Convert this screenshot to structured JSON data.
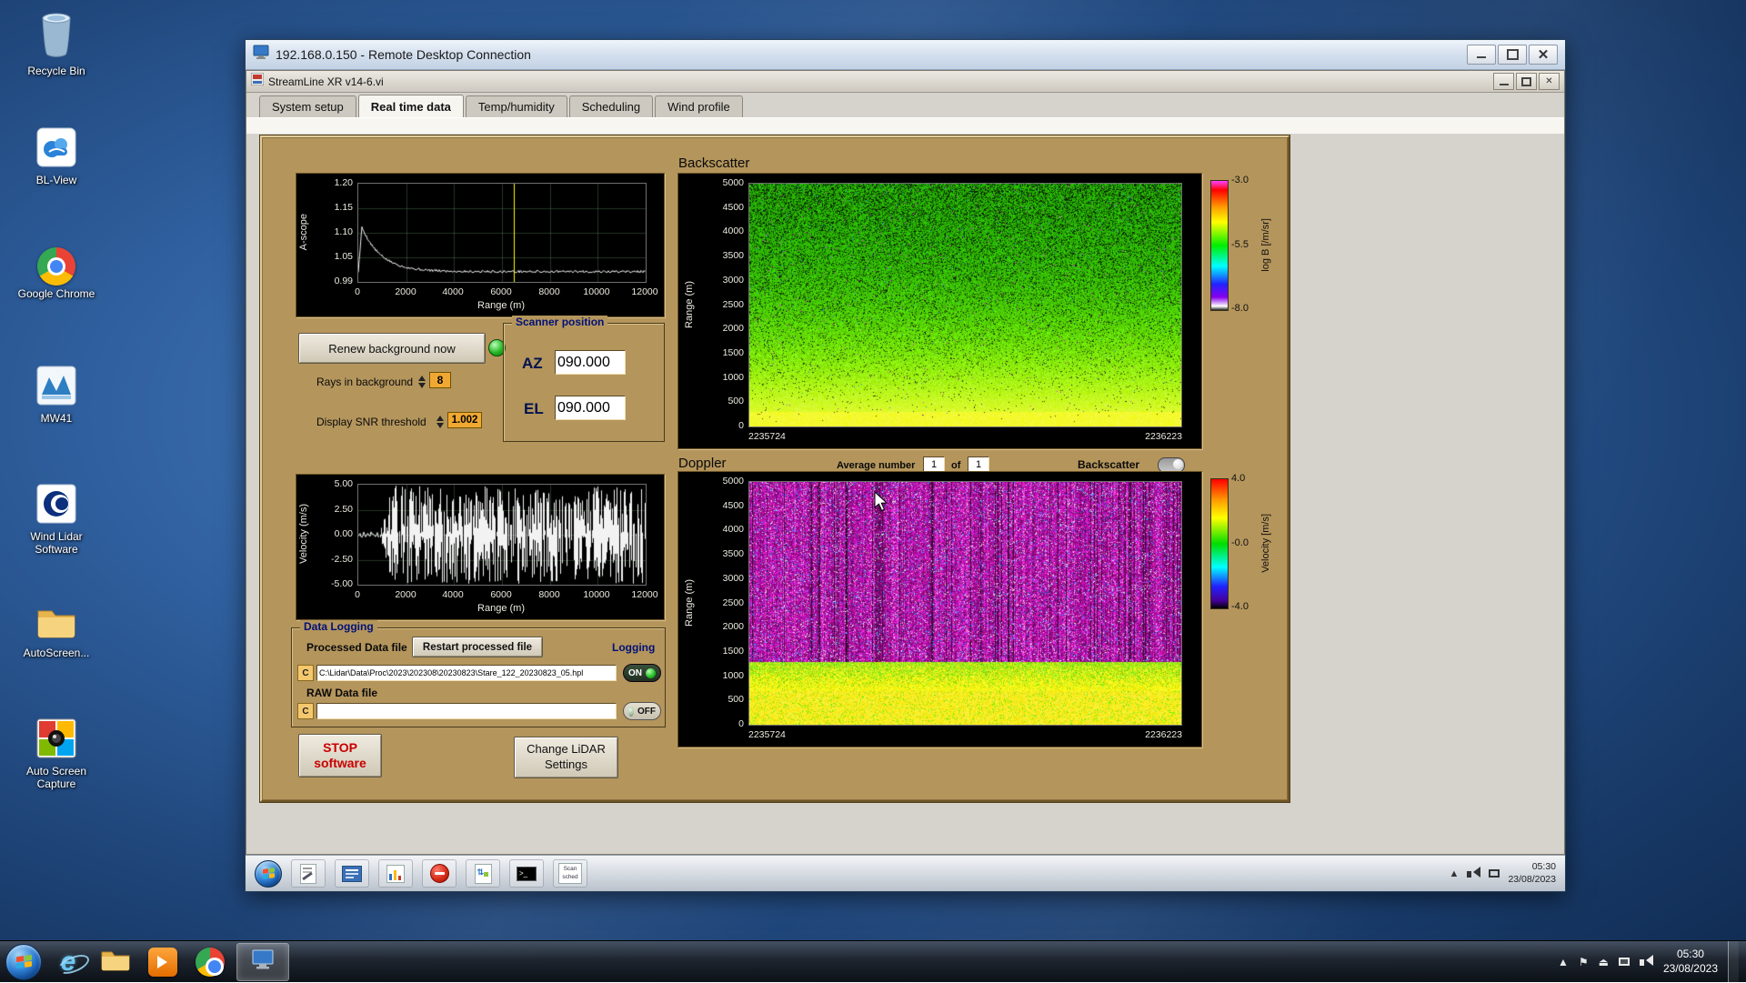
{
  "desktop": {
    "icons": [
      {
        "label": "Recycle Bin"
      },
      {
        "label": "BL-View"
      },
      {
        "label": "Google Chrome"
      },
      {
        "label": "MW41"
      },
      {
        "label": "Wind Lidar Software"
      },
      {
        "label": "AutoScreen..."
      },
      {
        "label": "Auto Screen Capture"
      }
    ]
  },
  "rdp": {
    "title": "192.168.0.150 - Remote Desktop Connection"
  },
  "app": {
    "title": "StreamLine XR v14-6.vi",
    "tabs": [
      "System setup",
      "Real time data",
      "Temp/humidity",
      "Scheduling",
      "Wind profile"
    ]
  },
  "panel": {
    "backscatter_title": "Backscatter",
    "doppler_title": "Doppler",
    "ascope": {
      "ylabel": "A-scope",
      "xlabel": "Range (m)",
      "yticks": [
        "1.20",
        "1.15",
        "1.10",
        "1.05",
        "0.99"
      ],
      "xticks": [
        "0",
        "2000",
        "4000",
        "6000",
        "8000",
        "10000",
        "12000"
      ]
    },
    "velocity": {
      "ylabel": "Velocity (m/s)",
      "xlabel": "Range (m)",
      "yticks": [
        "5.00",
        "2.50",
        "0.00",
        "-2.50",
        "-5.00"
      ],
      "xticks": [
        "0",
        "2000",
        "4000",
        "6000",
        "8000",
        "10000",
        "12000"
      ]
    },
    "bmap": {
      "ylabel": "Range (m)",
      "yticks": [
        "5000",
        "4500",
        "4000",
        "3500",
        "3000",
        "2500",
        "2000",
        "1500",
        "1000",
        "500",
        "0"
      ],
      "x_start": "2235724",
      "x_end": "2236223",
      "cb_label": "log B [/m/sr]",
      "cb_ticks": [
        "-3.0",
        "-5.5",
        "-8.0"
      ]
    },
    "dmap": {
      "ylabel": "Range (m)",
      "yticks": [
        "5000",
        "4500",
        "4000",
        "3500",
        "3000",
        "2500",
        "2000",
        "1500",
        "1000",
        "500",
        "0"
      ],
      "x_start": "2235724",
      "x_end": "2236223",
      "cb_label": "Velocity [m/s]",
      "cb_ticks": [
        "4.0",
        "-0.0",
        "-4.0"
      ]
    },
    "scanner": {
      "title": "Scanner position",
      "az_label": "AZ",
      "az_value": "090.000",
      "el_label": "EL",
      "el_value": "090.000"
    },
    "bg": {
      "renew_label": "Renew background now",
      "rays_label": "Rays in background",
      "rays_value": "8",
      "snr_label": "Display SNR threshold",
      "snr_value": "1.002"
    },
    "avg": {
      "label": "Average number",
      "value": "1",
      "of_label": "of",
      "count": "1",
      "switch_label": "Backscatter"
    },
    "log": {
      "title": "Data Logging",
      "processed_label": "Processed Data file",
      "restart_label": "Restart processed file",
      "logging_label": "Logging",
      "drive_label": "C",
      "path": "C:\\Lidar\\Data\\Proc\\2023\\202308\\20230823\\Stare_122_20230823_05.hpl",
      "on_label": "ON",
      "raw_label": "RAW Data file",
      "raw_path": "",
      "off_label": "OFF"
    },
    "stop": {
      "l1": "STOP",
      "l2": "software"
    },
    "change": {
      "l1": "Change LiDAR",
      "l2": "Settings"
    }
  },
  "remote_taskbar": {
    "scan_label": "Scan sched",
    "time": "05:30",
    "date": "23/08/2023"
  },
  "taskbar": {
    "time": "05:30",
    "date": "23/08/2023"
  },
  "colors": {
    "panel_tan": "#b4955c",
    "navy": "#001177",
    "orange": "#f0a832",
    "led_green": "#2fbe2f",
    "stop_red": "#cc0000"
  },
  "chart_data": [
    {
      "type": "line",
      "title": "A-scope",
      "xlabel": "Range (m)",
      "ylabel": "A-scope",
      "xlim": [
        0,
        12000
      ],
      "ylim": [
        0.99,
        1.2
      ],
      "cursor_x": 6500
    },
    {
      "type": "line",
      "title": "Velocity",
      "xlabel": "Range (m)",
      "ylabel": "Velocity (m/s)",
      "xlim": [
        0,
        12000
      ],
      "ylim": [
        -5.0,
        5.0
      ]
    },
    {
      "type": "heatmap",
      "title": "Backscatter",
      "ylabel": "Range (m)",
      "ylim": [
        0,
        5000
      ],
      "x_window": [
        "2235724",
        "2236223"
      ],
      "color_label": "log B [/m/sr]",
      "color_range": [
        -8.0,
        -3.0
      ]
    },
    {
      "type": "heatmap",
      "title": "Doppler",
      "ylabel": "Range (m)",
      "ylim": [
        0,
        5000
      ],
      "x_window": [
        "2235724",
        "2236223"
      ],
      "color_label": "Velocity [m/s]",
      "color_range": [
        -4.0,
        4.0
      ]
    }
  ]
}
